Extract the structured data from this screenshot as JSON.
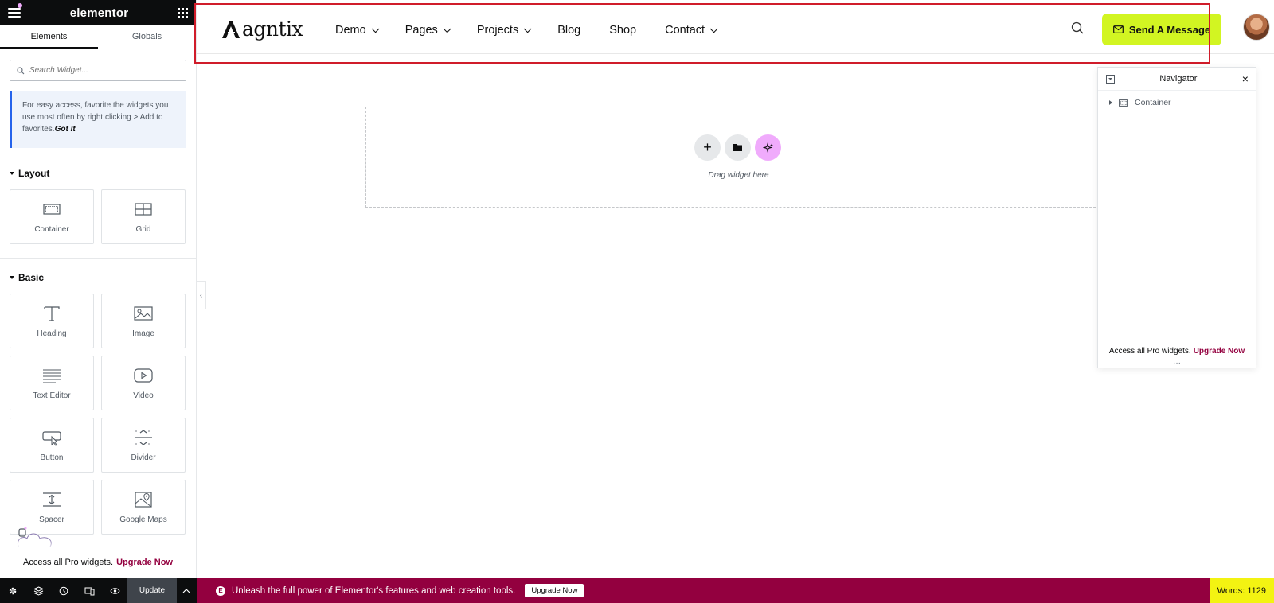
{
  "editor": {
    "logo": "elementor",
    "tabs": [
      "Elements",
      "Globals"
    ],
    "search_placeholder": "Search Widget...",
    "tip_text": "For easy access, favorite the widgets you use most often by right clicking > Add to favorites.",
    "tip_link": "Got It",
    "sections": [
      {
        "title": "Layout",
        "widgets": [
          {
            "label": "Container",
            "icon": "container-icon"
          },
          {
            "label": "Grid",
            "icon": "grid-icon"
          }
        ]
      },
      {
        "title": "Basic",
        "widgets": [
          {
            "label": "Heading",
            "icon": "heading-icon"
          },
          {
            "label": "Image",
            "icon": "image-icon"
          },
          {
            "label": "Text Editor",
            "icon": "text-editor-icon"
          },
          {
            "label": "Video",
            "icon": "video-icon"
          },
          {
            "label": "Button",
            "icon": "button-icon"
          },
          {
            "label": "Divider",
            "icon": "divider-icon"
          },
          {
            "label": "Spacer",
            "icon": "spacer-icon"
          },
          {
            "label": "Google Maps",
            "icon": "google-maps-icon"
          }
        ]
      }
    ],
    "pro_text": "Access all Pro widgets.",
    "pro_link": "Upgrade Now",
    "bottom_update": "Update",
    "promo_text": "Unleash the full power of Elementor's features and web creation tools.",
    "promo_button": "Upgrade Now",
    "words_count": "Words: 1129"
  },
  "site": {
    "brand": "agntix",
    "menu": [
      {
        "label": "Demo",
        "has_dropdown": true
      },
      {
        "label": "Pages",
        "has_dropdown": true
      },
      {
        "label": "Projects",
        "has_dropdown": true
      },
      {
        "label": "Blog",
        "has_dropdown": false
      },
      {
        "label": "Shop",
        "has_dropdown": false
      },
      {
        "label": "Contact",
        "has_dropdown": true
      }
    ],
    "cta_label": "Send A Message",
    "cta_color": "#d2f522"
  },
  "canvas": {
    "drag_text": "Drag widget here"
  },
  "navigator": {
    "title": "Navigator",
    "items": [
      "Container"
    ],
    "footer_text": "Access all Pro widgets.",
    "footer_link": "Upgrade Now"
  },
  "colors": {
    "accent": "#93003f",
    "highlight_box": "#d01c2a",
    "ai_button": "#f0abfc"
  }
}
